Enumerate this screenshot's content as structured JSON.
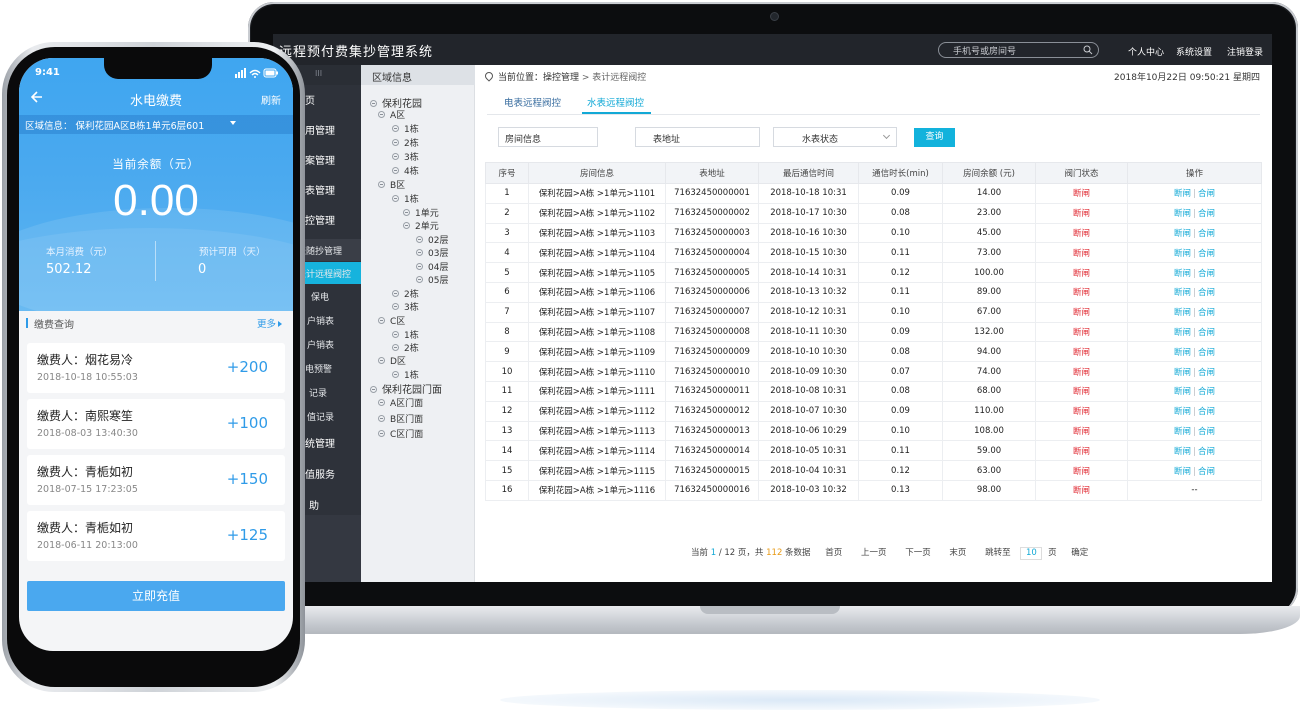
{
  "colors": {
    "accent": "#12b2dc",
    "nav_bg": "#2e323a",
    "off_state": "#e0262f",
    "phone_blue": "#3fa6f0"
  },
  "laptop": {
    "app_title": "远程预付费集抄管理系统",
    "search_placeholder": "手机号或房间号",
    "top_links": [
      "个人中心",
      "系统设置",
      "注销登录"
    ],
    "nav_top_label": "III",
    "nav": [
      "页",
      "用管理",
      "案管理",
      "表管理",
      "控管理",
      "表随抄管理",
      "表计远程阀控",
      "保电",
      "户销表",
      "户销表",
      "电预警",
      "记录",
      "值记录",
      "统管理",
      "值服务",
      "助"
    ],
    "tree": {
      "header": "区域信息",
      "nodes": [
        "保利花园",
        "A区",
        "1栋",
        "2栋",
        "3栋",
        "4栋",
        "B区",
        "1栋",
        "1单元",
        "2单元",
        "02层",
        "03层",
        "04层",
        "05层",
        "2栋",
        "3栋",
        "C区",
        "1栋",
        "2栋",
        "D区",
        "1栋",
        "保利花园门面",
        "A区门面",
        "B区门面",
        "C区门面"
      ]
    },
    "crumb": {
      "prefix": "当前位置：",
      "section": "操控管理",
      "sep": " > ",
      "page": "表计远程阀控"
    },
    "datetime": "2018年10月22日    09:50:21    星期四",
    "tabs": [
      "电表远程阀控",
      "水表远程阀控"
    ],
    "filters": {
      "room": "房间信息",
      "address": "表地址",
      "status": "水表状态",
      "query_label": "查询"
    },
    "table": {
      "headers": [
        "序号",
        "房间信息",
        "表地址",
        "最后通信时间",
        "通信时长(min)",
        "房间余额 (元)",
        "阀门状态",
        "操作"
      ],
      "op_off": "断闸",
      "op_on": "合闸",
      "rows": [
        [
          "1",
          "保利花园>A栋 >1单元>1101",
          "71632450000001",
          "2018-10-18 10:31",
          "0.09",
          "14.00",
          "断闸"
        ],
        [
          "2",
          "保利花园>A栋 >1单元>1102",
          "71632450000002",
          "2018-10-17 10:30",
          "0.08",
          "23.00",
          "断闸"
        ],
        [
          "3",
          "保利花园>A栋 >1单元>1103",
          "71632450000003",
          "2018-10-16 10:30",
          "0.10",
          "45.00",
          "断闸"
        ],
        [
          "4",
          "保利花园>A栋 >1单元>1104",
          "71632450000004",
          "2018-10-15 10:30",
          "0.11",
          "73.00",
          "断闸"
        ],
        [
          "5",
          "保利花园>A栋 >1单元>1105",
          "71632450000005",
          "2018-10-14 10:31",
          "0.12",
          "100.00",
          "断闸"
        ],
        [
          "6",
          "保利花园>A栋 >1单元>1106",
          "71632450000006",
          "2018-10-13 10:32",
          "0.11",
          "89.00",
          "断闸"
        ],
        [
          "7",
          "保利花园>A栋 >1单元>1107",
          "71632450000007",
          "2018-10-12 10:31",
          "0.10",
          "67.00",
          "断闸"
        ],
        [
          "8",
          "保利花园>A栋 >1单元>1108",
          "71632450000008",
          "2018-10-11 10:30",
          "0.09",
          "132.00",
          "断闸"
        ],
        [
          "9",
          "保利花园>A栋 >1单元>1109",
          "71632450000009",
          "2018-10-10 10:30",
          "0.08",
          "94.00",
          "断闸"
        ],
        [
          "10",
          "保利花园>A栋 >1单元>1110",
          "71632450000010",
          "2018-10-09 10:30",
          "0.07",
          "74.00",
          "断闸"
        ],
        [
          "11",
          "保利花园>A栋 >1单元>1111",
          "71632450000011",
          "2018-10-08 10:31",
          "0.08",
          "68.00",
          "断闸"
        ],
        [
          "12",
          "保利花园>A栋 >1单元>1112",
          "71632450000012",
          "2018-10-07 10:30",
          "0.09",
          "110.00",
          "断闸"
        ],
        [
          "13",
          "保利花园>A栋 >1单元>1113",
          "71632450000013",
          "2018-10-06 10:29",
          "0.10",
          "108.00",
          "断闸"
        ],
        [
          "14",
          "保利花园>A栋 >1单元>1114",
          "71632450000014",
          "2018-10-05 10:31",
          "0.11",
          "59.00",
          "断闸"
        ],
        [
          "15",
          "保利花园>A栋 >1单元>1115",
          "71632450000015",
          "2018-10-04 10:31",
          "0.12",
          "63.00",
          "断闸"
        ],
        [
          "16",
          "保利花园>A栋 >1单元>1116",
          "71632450000016",
          "2018-10-03 10:32",
          "0.13",
          "98.00",
          "断闸"
        ]
      ],
      "last_row_op": "--"
    },
    "pager": {
      "t1": "当前 ",
      "cur": "1",
      "t2": " / 12 页，共 ",
      "total": "112",
      "t3": " 条数据",
      "first": "首页",
      "prev": "上一页",
      "next": "下一页",
      "last": "末页",
      "jump_label": "跳转至",
      "jump_val": "10",
      "page_unit": "页",
      "confirm": "确定"
    }
  },
  "phone": {
    "time": "9:41",
    "title": "水电缴费",
    "refresh": "刷新",
    "region": "区域信息：  保利花园A区B栋1单元6层601",
    "balance_label": "当前余额（元）",
    "balance": "0.00",
    "month_label": "本月消费（元）",
    "month_value": "502.12",
    "est_label": "预计可用（天）",
    "est_value": "0",
    "records_title": "缴费查询",
    "more": "更多",
    "records": [
      {
        "who": "缴费人：烟花易冷",
        "when": "2018-10-18   10:55:03",
        "amount": "+200"
      },
      {
        "who": "缴费人：南熙寒笙",
        "when": "2018-08-03   13:40:30",
        "amount": "+100"
      },
      {
        "who": "缴费人：青栀如初",
        "when": "2018-07-15   17:23:05",
        "amount": "+150"
      },
      {
        "who": "缴费人：青栀如初",
        "when": "2018-06-11   20:13:00",
        "amount": "+125"
      }
    ],
    "recharge": "立即充值"
  }
}
